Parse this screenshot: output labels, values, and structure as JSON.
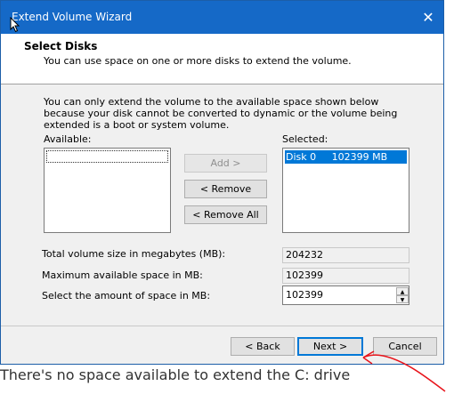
{
  "window": {
    "title": "Extend Volume Wizard",
    "close_symbol": "✕"
  },
  "header": {
    "title": "Select Disks",
    "subtitle": "You can use space on one or more disks to extend the volume."
  },
  "description": "You can only extend the volume to the available space shown below because your disk cannot be converted to dynamic or the volume being extended is a boot or system volume.",
  "lists": {
    "available_label": "Available:",
    "selected_label": "Selected:",
    "selected_items": [
      "Disk 0     102399 MB"
    ]
  },
  "buttons": {
    "add": "Add >",
    "remove": "< Remove",
    "remove_all": "< Remove All",
    "back": "< Back",
    "next": "Next >",
    "cancel": "Cancel"
  },
  "sizes": {
    "total_label": "Total volume size in megabytes (MB):",
    "total_value": "204232",
    "max_label": "Maximum available space in MB:",
    "max_value": "102399",
    "amount_label": "Select the amount of space in MB:",
    "amount_value": "102399"
  },
  "caption": "There's no space available to extend the C: drive",
  "colors": {
    "titlebar": "#1569c7",
    "selection": "#0078d7",
    "annotation": "#e8141b"
  }
}
